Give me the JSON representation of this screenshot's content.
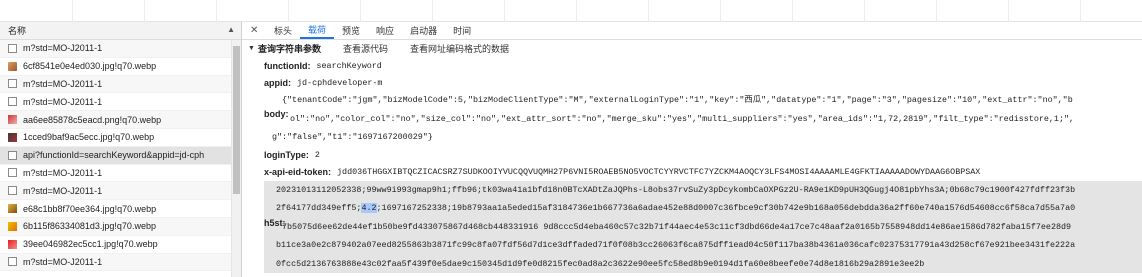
{
  "list": {
    "header": "名称",
    "rows": [
      {
        "name": "m?std=MO-J2011-1",
        "icon": "doc-icon"
      },
      {
        "name": "6cf8541e0e4ed030.jpg!q70.webp",
        "icon": "image-icon"
      },
      {
        "name": "m?std=MO-J2011-1",
        "icon": "doc-icon"
      },
      {
        "name": "m?std=MO-J2011-1",
        "icon": "doc-icon"
      },
      {
        "name": "aa6ee85878c5eacd.png!q70.webp",
        "icon": "image-icon"
      },
      {
        "name": "1cced9baf9ac5ecc.jpg!q70.webp",
        "icon": "image-icon"
      },
      {
        "name": "api?functionId=searchKeyword&appid=jd-cph",
        "icon": "doc-icon"
      },
      {
        "name": "m?std=MO-J2011-1",
        "icon": "doc-icon"
      },
      {
        "name": "m?std=MO-J2011-1",
        "icon": "doc-icon"
      },
      {
        "name": "e68c1bb8f70ee364.jpg!q70.webp",
        "icon": "image-icon"
      },
      {
        "name": "6b115f86334081d3.jpg!q70.webp",
        "icon": "image-icon"
      },
      {
        "name": "39ee046982ec5cc1.jpg!q70.webp",
        "icon": "image-icon"
      },
      {
        "name": "m?std=MO-J2011-1",
        "icon": "doc-icon"
      }
    ]
  },
  "tabs": [
    "标头",
    "载荷",
    "预览",
    "响应",
    "启动器",
    "时间"
  ],
  "active_tab": "载荷",
  "section": {
    "title": "查询字符串参数",
    "links": [
      "查看源代码",
      "查看网址编码格式的数据"
    ]
  },
  "params": {
    "functionId_key": "functionId:",
    "functionId_val": "searchKeyword",
    "appid_key": "appid:",
    "appid_val": "jd-cphdeveloper-m",
    "body_key": "body:",
    "body_line1": "{\"tenantCode\":\"jgm\",\"bizModelCode\":5,\"bizModeClientType\":\"M\",\"externalLoginType\":\"1\",\"key\":\"西瓜\",\"datatype\":\"1\",\"page\":\"3\",\"pagesize\":\"10\",\"ext_attr\":\"no\",\"b",
    "body_line2": "ol\":\"no\",\"color_col\":\"no\",\"size_col\":\"no\",\"ext_attr_sort\":\"no\",\"merge_sku\":\"yes\",\"multi_suppliers\":\"yes\",\"area_ids\":\"1,72,2819\",\"filt_type\":\"redisstore,1;\",",
    "body_line3": "g\":\"false\",\"t1\":\"1697167200029\"}",
    "loginType_key": "loginType:",
    "loginType_val": "2",
    "eid_key": "x-api-eid-token:",
    "eid_val": "jdd036THGGXIBTQCZICACSRZ7SUDKOOIYVUCQQVUQMH27P6VNI5ROAEB5NO5VOCTCYYRVCTFC7YZCKM4AOQCY3LFS4MOSI4AAAAMLE4GFKTIAAAAADOWYDAAG6OBPSAX",
    "h5st_key": "h5st:",
    "h5st_line1": "20231013112052338;99ww9i993gmap9h1;ffb96;tk03wa41a1bfd18n0BTcXADtZaJQPhs-L8obs37rvSuZy3pDcykombCaOXPGz2U-RA9e1KD9pUH3QGugj4O81pbYhs3A;0b68c79c1900f427fdff23f3b",
    "h5st_line2a": "2f64177dd349eff5;",
    "h5st_line2hl": "4.2",
    "h5st_line2b": ";1697167252338;19b8793aa1a5eded15af3184736e1b667736a6adae452e88d0007c36fbce9cf30b742e9b168a056debdda36a2ff60e740a1576d54608cc6f58ca7d55a7a0",
    "h5st_line3": "7b5075d6ee62de44ef1b50be9fd433075867d468cb448331916 9d8ccc5d4eba460c57c32b71f44aec4e53c11cf3dbd66de4a17ce7c48aaf2a0165b7558948dd14e86ae1586d782faba15f7ee28d9",
    "h5st_line4": "b11ce3a0e2c879402a07eed8255863b3871fc99c8fa07fdf56d7d1ce3dffaded71f0f08b3cc26063f6ca875dff1ead04c50f117ba38b4361a036cafc02375317791a43d258cf67e921bee3431fe222a",
    "h5st_line5": "0fcc5d2136763888e43c02faa5f439f0e5dae9c150345d1d9fe0d8215fec0ad8a2c3622e90ee5fc58ed8b9e0194d1fa60e8beefe0e74d8e1816b29a2891e3ee2b"
  }
}
